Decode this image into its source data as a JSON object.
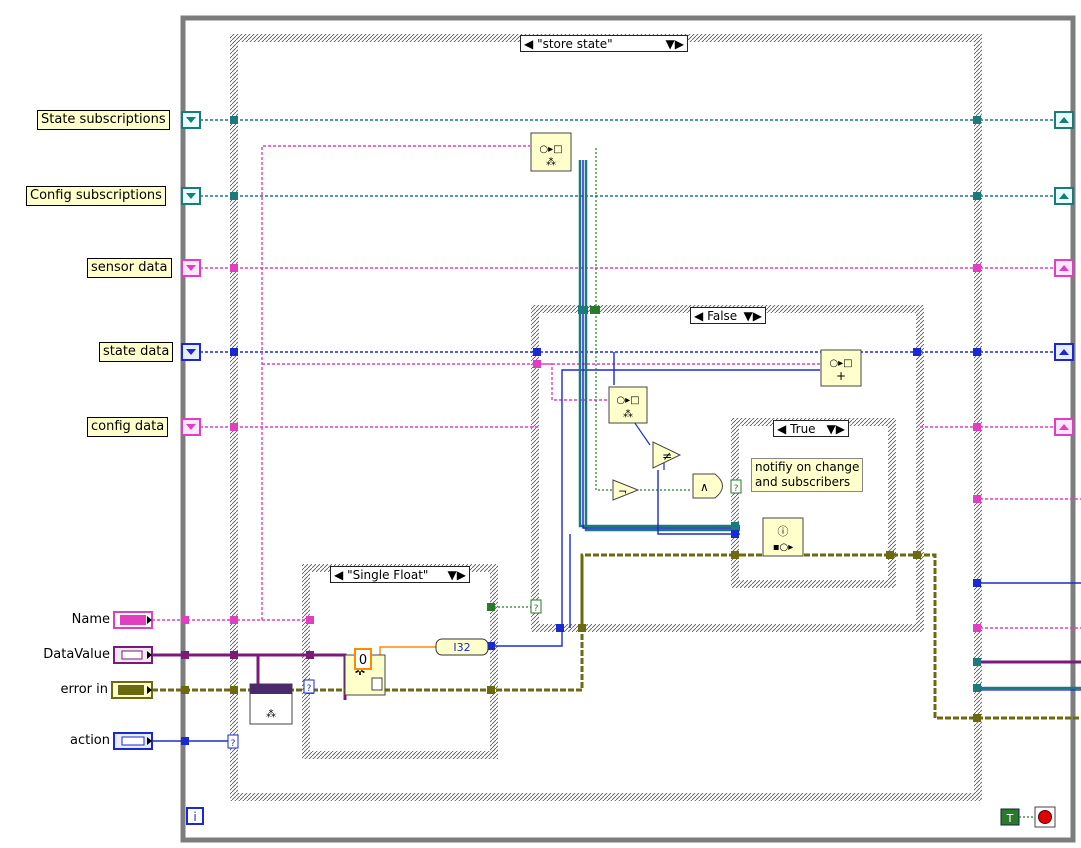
{
  "controls": {
    "state_subscriptions": "State subscriptions",
    "config_subscriptions": "Config subscriptions",
    "sensor_data": "sensor data",
    "state_data": "state data",
    "config_data": "config data",
    "name": "Name",
    "data_value": "DataValue",
    "error_in": "error in",
    "action": "action"
  },
  "cases": {
    "outer": "\"store state\"",
    "single_float": "\"Single Float\"",
    "false_case": "False",
    "true_case": "True"
  },
  "constants": {
    "zero": "0",
    "i32": "I32",
    "bool_true": "T",
    "iteration": "i"
  },
  "comment": {
    "line1": "notifiy on change",
    "line2": "and subscribers"
  },
  "wire_colors": {
    "cluster_teal": "#1d7a7a",
    "string_pink": "#e040c0",
    "enum_blue": "#1a2ad0",
    "error_olive": "#6b6a10",
    "bool_green": "#2a7a2a",
    "numeric_orange": "#ff8a00",
    "variant_purple": "#7a1a7a"
  }
}
